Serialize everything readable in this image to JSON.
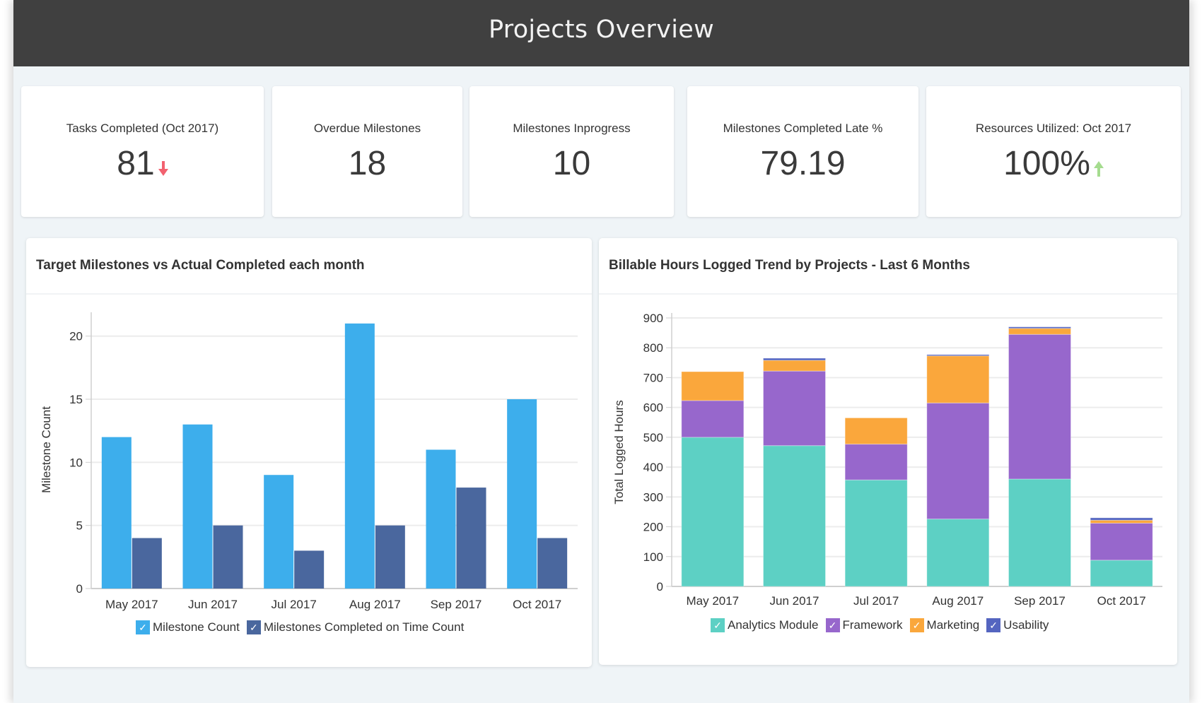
{
  "header": {
    "title": "Projects Overview"
  },
  "kpis": [
    {
      "label": "Tasks Completed (Oct 2017)",
      "value": "81",
      "trend": "down",
      "trend_icon": "arrow-down-icon",
      "trend_color": "#f2616f"
    },
    {
      "label": "Overdue Milestones",
      "value": "18"
    },
    {
      "label": "Milestones Inprogress",
      "value": "10"
    },
    {
      "label": "Milestones Completed Late %",
      "value": "79.19"
    },
    {
      "label": "Resources Utilized: Oct 2017",
      "value": "100%",
      "trend": "up",
      "trend_icon": "arrow-up-icon",
      "trend_color": "#a5dc8f"
    }
  ],
  "panels": {
    "left_title": "Target Milestones vs Actual Completed each month",
    "right_title": "Billable Hours Logged Trend by Projects - Last 6 Months"
  },
  "legend_check": "✓",
  "chart_data": [
    {
      "type": "bar",
      "title": "Target Milestones vs Actual Completed each month",
      "xlabel": "",
      "ylabel": "Milestone Count",
      "ylim": [
        0,
        22
      ],
      "yticks": [
        0,
        5,
        10,
        15,
        20
      ],
      "grid": true,
      "legend": "bottom",
      "categories": [
        "May 2017",
        "Jun 2017",
        "Jul 2017",
        "Aug 2017",
        "Sep 2017",
        "Oct 2017"
      ],
      "series": [
        {
          "name": "Milestone Count",
          "color": "#3daeec",
          "values": [
            12,
            13,
            9,
            21,
            11,
            15
          ]
        },
        {
          "name": "Milestones Completed on Time Count",
          "color": "#4a679e",
          "values": [
            4,
            5,
            3,
            5,
            8,
            4
          ]
        }
      ]
    },
    {
      "type": "bar",
      "stacked": true,
      "title": "Billable Hours Logged Trend by Projects - Last 6 Months",
      "xlabel": "",
      "ylabel": "Total Logged Hours",
      "ylim": [
        0,
        900
      ],
      "yticks": [
        0,
        100,
        200,
        300,
        400,
        500,
        600,
        700,
        800,
        900
      ],
      "grid": true,
      "legend": "bottom",
      "categories": [
        "May 2017",
        "Jun 2017",
        "Jul 2017",
        "Aug 2017",
        "Sep 2017",
        "Oct 2017"
      ],
      "series": [
        {
          "name": "Analytics Module",
          "color": "#5dd0c4",
          "values": [
            500,
            472,
            357,
            226,
            360,
            88
          ]
        },
        {
          "name": "Framework",
          "color": "#9767cc",
          "values": [
            123,
            250,
            120,
            389,
            485,
            124
          ]
        },
        {
          "name": "Marketing",
          "color": "#faa73c",
          "values": [
            97,
            36,
            88,
            158,
            20,
            10
          ]
        },
        {
          "name": "Usability",
          "color": "#5465c0",
          "values": [
            0,
            7,
            0,
            4,
            5,
            8
          ]
        }
      ]
    }
  ]
}
